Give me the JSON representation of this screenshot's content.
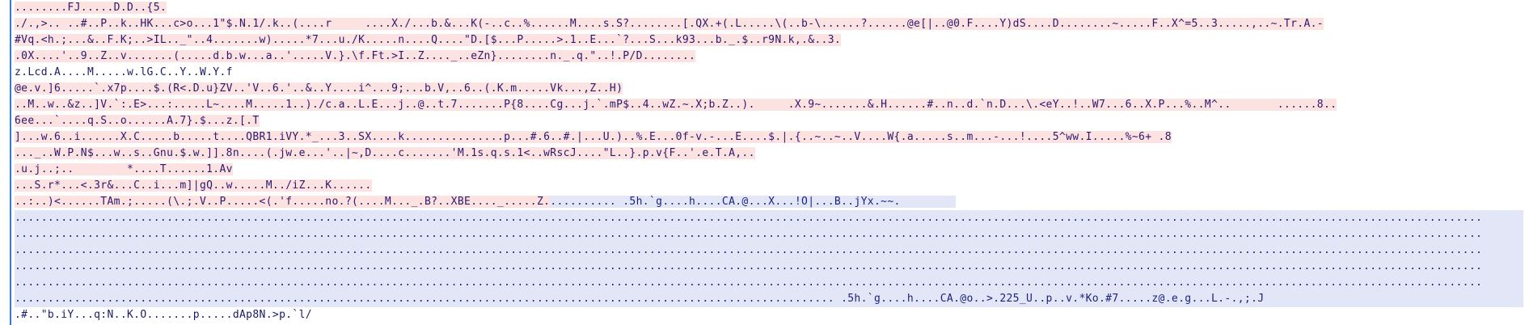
{
  "colors": {
    "pink_highlight": "#fde2e2",
    "blue_highlight": "#e3e6f7",
    "text": "#1a1a66",
    "gutter_line": "#2f7bd6"
  },
  "lines": [
    {
      "text": "........FJ.....D.D..{5.",
      "style": "pink"
    },
    {
      "text": "./.,>.. ..#..P..k..HK...c>o...1\"$.N.1/.k..(....r     ....X./...b.&...K(-..c..%......M....s.S?........[.QX.+(.L.....\\(..b-\\......?......@e[|..@0.F....Y)dS....D........~.....F..X^=5..3.....,..~.Tr.A.-",
      "style": "pink"
    },
    {
      "text": "#Vq.<h.;...&..F.K;..>IL.._\"..4.......w).....*7...u./K.....n....Q....\"D.[$...P.....>.1..E...`?...S...k93...b._.$..r9N.k,.&..3.",
      "style": "pink"
    },
    {
      "text": ".0X....'..9..Z..v.......(.....d.b.w...a..'.....V.}.\\f.Ft.>I..Z...._..eZn}........n._.q.\"..!.P/D........",
      "style": "pink"
    },
    {
      "text": "z.Lcd.A....M.....w.lG.C..Y..W.Y.f",
      "style": "plain"
    },
    {
      "text": "@e.v.]6.....`.x7p....$.(R<.D.u}ZV..'V..6.'..&..Y....i^...9;...b.V,..6..(.K.m.....Vk...,Z..H)",
      "style": "pink"
    },
    {
      "text": "..M..w..&z..]V.`:.E>...:.....L~....M.....1..)./c.a..L.E...j..@..t.7.......P{8....Cg...j.`.mP$..4..wZ.~.X;b.Z..).     .X.9~.......&.H......#..n..d.`n.D...\\.<eY..!..W7...6..X.P...%..M^..       ......8..",
      "style": "pink"
    },
    {
      "text": "6ee...`....q.S..o......A.7}.$...z.[.T",
      "style": "pink"
    },
    {
      "text": "]...w.6..i......X.C.....b.....t....QBR1.iVY.*_...3..SX....k...............p...#.6..#.|...U.)..%.E...0f-v.-...E....$.|.{..~..~..V....W{.a.....s..m...-...!....5^ww.I.....%~6+ .8",
      "style": "pink"
    },
    {
      "text": "..._..W.P.N$...w..s..Gnu.$.w.]].8n....(.jw.e...'..|~,D....c.......'M.1s.q.s.1<..wRscJ....\"L..}.p.v{F..'.e.T.A,..",
      "style": "pink"
    },
    {
      "text": ".u.j..;..        *....T......1.Av",
      "style": "pink"
    },
    {
      "text": "...S.r*...<.3r&...C..i...m]|gQ..w.....M../iZ...K......",
      "style": "pink"
    },
    {
      "text": "..:..)<......TAm.;.....(\\.;.V..P.....<(.'f.....no.?(....M..._.B?..XBE...._.....Z.",
      "blue_text": ".......... .5h.`g....h....CA.@...X...!O|...B..jYx.~~.",
      "style": "mix"
    },
    {
      "text": "..............................................................................................................................................................................................................................",
      "style": "fullblue"
    },
    {
      "text": "..............................................................................................................................................................................................................................",
      "style": "fullblue"
    },
    {
      "text": "..............................................................................................................................................................................................................................",
      "style": "fullblue"
    },
    {
      "text": "..............................................................................................................................................................................................................................",
      "style": "fullblue"
    },
    {
      "text": "..............................................................................................................................................................................................................................",
      "style": "fullblue"
    },
    {
      "text": "............................................................................................................................ .5h.`g....h....CA.@o..>.225_U..p..v.*Ko.#7.....z@.e.g...L.-.,;.J",
      "style": "fullblue"
    },
    {
      "text": ".#..\"b.iY...q:N..K.O.......p.....dAp8N.>p.`l/",
      "style": "plain"
    }
  ]
}
